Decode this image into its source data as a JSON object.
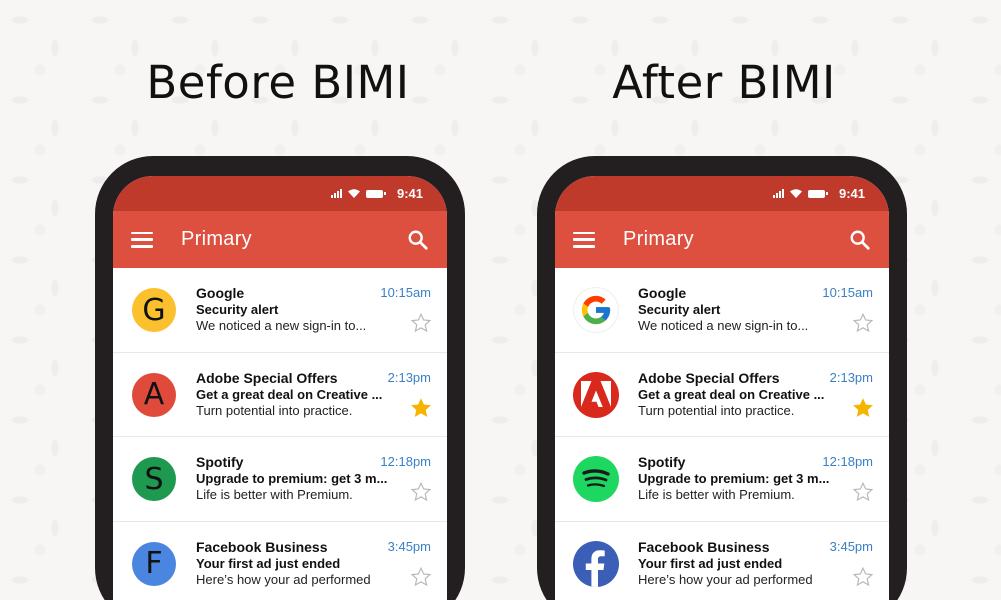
{
  "headings": {
    "before": "Before BIMI",
    "after": "After BIMI"
  },
  "phone": {
    "time": "9:41",
    "title": "Primary"
  },
  "colors": {
    "status_bar": "#bf3a2b",
    "app_bar": "#dd4f3f",
    "time_blue": "#3a80c6",
    "star_gold": "#f5b400"
  },
  "emails": [
    {
      "sender": "Google",
      "subject": "Security alert",
      "preview": "We noticed a new sign-in to...",
      "time": "10:15am",
      "starred": false,
      "letter": "G",
      "avatar_color": "#fbc02d",
      "brand_icon": "google-logo-icon"
    },
    {
      "sender": "Adobe Special Offers",
      "subject": "Get a great deal on Creative ...",
      "preview": "Turn potential into practice.",
      "time": "2:13pm",
      "starred": true,
      "letter": "A",
      "avatar_color": "#e04a3b",
      "brand_icon": "adobe-logo-icon"
    },
    {
      "sender": "Spotify",
      "subject": "Upgrade to premium: get 3 m...",
      "preview": "Life is better with Premium.",
      "time": "12:18pm",
      "starred": false,
      "letter": "S",
      "avatar_color": "#1d9a50",
      "brand_icon": "spotify-logo-icon"
    },
    {
      "sender": "Facebook Business",
      "subject": "Your first ad just ended",
      "preview": "Here’s how your ad performed",
      "time": "3:45pm",
      "starred": false,
      "letter": "F",
      "avatar_color": "#4a86e0",
      "brand_icon": "facebook-logo-icon"
    }
  ]
}
